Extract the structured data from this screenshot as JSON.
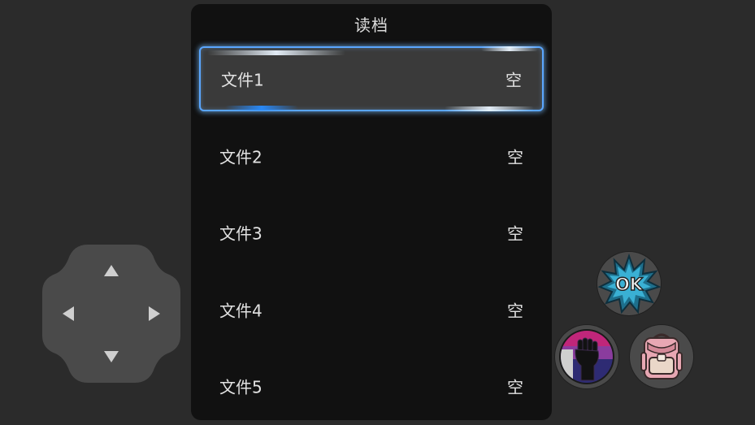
{
  "dialog": {
    "title": "读档",
    "slots": [
      {
        "name": "文件1",
        "status": "空"
      },
      {
        "name": "文件2",
        "status": "空"
      },
      {
        "name": "文件3",
        "status": "空"
      },
      {
        "name": "文件4",
        "status": "空"
      },
      {
        "name": "文件5",
        "status": "空"
      }
    ]
  },
  "controls": {
    "ok_label": "OK",
    "icons": [
      "up-arrow-icon",
      "down-arrow-icon",
      "left-arrow-icon",
      "right-arrow-icon",
      "fist-icon",
      "backpack-icon"
    ]
  },
  "colors": {
    "background": "#2b2b2b",
    "dialog": "#111111",
    "selected_slot": "#3a3a3a",
    "selection_border": "#5aa6ff"
  }
}
